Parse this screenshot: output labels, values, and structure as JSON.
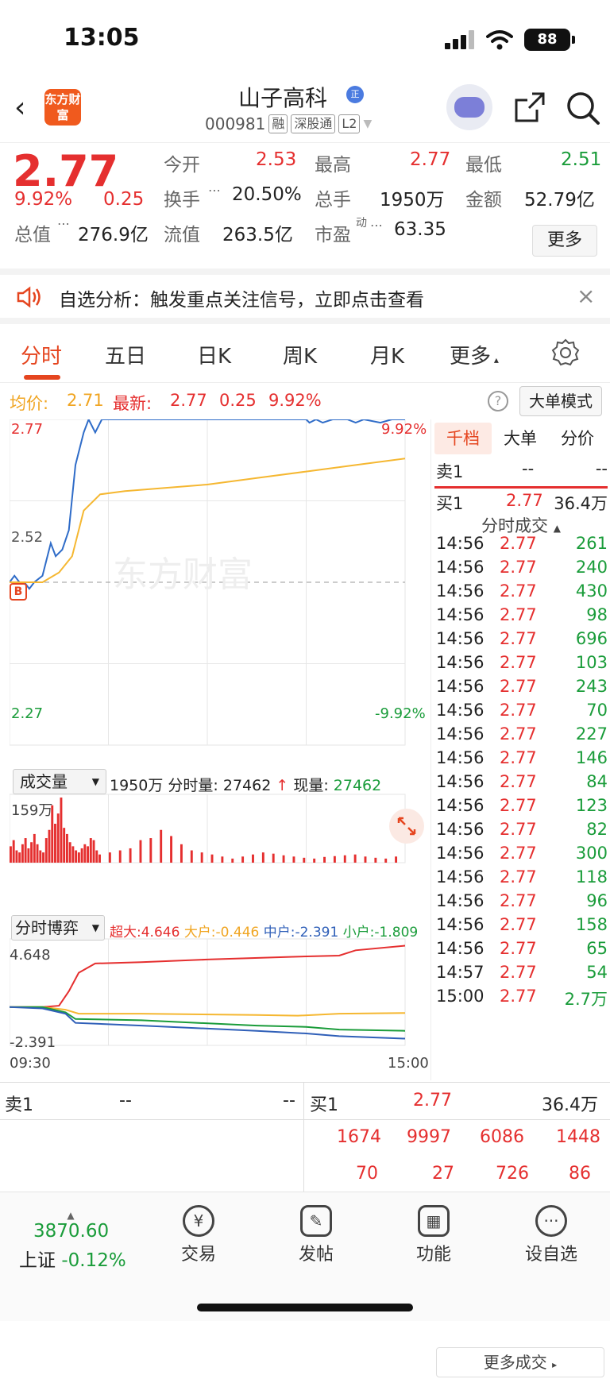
{
  "status_bar": {
    "time": "13:05",
    "battery": "88"
  },
  "header": {
    "logo_text": "东方财富",
    "stock_name": "山子高科",
    "verified_badge": "正",
    "code": "000981",
    "tags": [
      "融",
      "深股通",
      "L2"
    ]
  },
  "quote": {
    "price": "2.77",
    "change_pct": "9.92%",
    "change": "0.25",
    "open_label": "今开",
    "open": "2.53",
    "high_label": "最高",
    "high": "2.77",
    "low_label": "最低",
    "low": "2.51",
    "turnover_label": "换手",
    "turnover": "20.50%",
    "volume_label": "总手",
    "volume": "1950万",
    "amount_label": "金额",
    "amount": "52.79亿",
    "mktcap_label": "总值",
    "mktcap": "276.9亿",
    "float_label": "流值",
    "float": "263.5亿",
    "pe_label": "市盈",
    "pe_sup": "动",
    "pe": "63.35",
    "more": "更多"
  },
  "alert": {
    "text": "自选分析：触发重点关注信号，立即点击查看",
    "close": "×"
  },
  "tabs": [
    {
      "label": "分时",
      "active": true
    },
    {
      "label": "五日"
    },
    {
      "label": "日K"
    },
    {
      "label": "周K"
    },
    {
      "label": "月K"
    },
    {
      "label": "更多"
    }
  ],
  "chart_info": {
    "avg_label": "均价:",
    "avg": "2.71",
    "latest_label": "最新:",
    "latest": "2.77",
    "change": "0.25",
    "change_pct": "9.92%",
    "help": "?",
    "big_mode": "大单模式"
  },
  "chart_data": {
    "type": "line",
    "price_axis": {
      "top": "2.77",
      "mid": "2.52",
      "bottom": "2.27",
      "top_pct": "9.92%",
      "bottom_pct": "-9.92%"
    },
    "ylim": [
      2.27,
      2.77
    ],
    "prev_close": 2.52,
    "watermark": "东方财富",
    "marker": "B",
    "series": [
      {
        "color": "#2f6cc8",
        "points": [
          [
            0,
            2.52
          ],
          [
            3,
            2.53
          ],
          [
            6,
            2.52
          ],
          [
            9,
            2.52
          ],
          [
            12,
            2.51
          ],
          [
            15,
            2.52
          ],
          [
            20,
            2.53
          ],
          [
            25,
            2.58
          ],
          [
            28,
            2.56
          ],
          [
            32,
            2.57
          ],
          [
            36,
            2.6
          ],
          [
            40,
            2.7
          ],
          [
            45,
            2.75
          ],
          [
            48,
            2.77
          ],
          [
            52,
            2.75
          ],
          [
            56,
            2.77
          ],
          [
            100,
            2.77
          ],
          [
            150,
            2.77
          ],
          [
            180,
            2.77
          ],
          [
            182,
            2.765
          ],
          [
            186,
            2.77
          ],
          [
            190,
            2.765
          ],
          [
            196,
            2.77
          ],
          [
            205,
            2.77
          ],
          [
            210,
            2.765
          ],
          [
            215,
            2.77
          ],
          [
            225,
            2.765
          ],
          [
            232,
            2.77
          ],
          [
            240,
            2.77
          ]
        ]
      },
      {
        "color": "#f5b731",
        "points": [
          [
            0,
            2.52
          ],
          [
            10,
            2.52
          ],
          [
            20,
            2.52
          ],
          [
            30,
            2.535
          ],
          [
            38,
            2.56
          ],
          [
            45,
            2.63
          ],
          [
            55,
            2.655
          ],
          [
            70,
            2.66
          ],
          [
            95,
            2.665
          ],
          [
            120,
            2.67
          ],
          [
            150,
            2.68
          ],
          [
            180,
            2.69
          ],
          [
            210,
            2.7
          ],
          [
            240,
            2.71
          ]
        ]
      }
    ],
    "volume": {
      "max_label": "159万",
      "bars": [
        40,
        55,
        30,
        25,
        45,
        60,
        35,
        50,
        70,
        45,
        30,
        25,
        60,
        80,
        140,
        95,
        120,
        159,
        85,
        70,
        50,
        40,
        30,
        25,
        35,
        45,
        40,
        60,
        55,
        30,
        20,
        25,
        30,
        35,
        55,
        60,
        80,
        65,
        45,
        30,
        25,
        20,
        15,
        10,
        15,
        20,
        25,
        22,
        18,
        15,
        12,
        10,
        14,
        16,
        18,
        20,
        15,
        12,
        10,
        15
      ]
    },
    "flow": {
      "ymax_label": "4.648",
      "ymin_label": "-2.391",
      "xstart": "09:30",
      "xend": "15:00"
    }
  },
  "volume_bar": {
    "dropdown": "成交量",
    "total": "1950万",
    "fs_label": "分时量:",
    "fs": "27462",
    "now_label": "现量:",
    "now": "27462"
  },
  "flow_bar": {
    "dropdown": "分时博弈",
    "xl": "超大:4.646",
    "big": "大户:-0.446",
    "mid": "中户:-2.391",
    "small": "小户:-1.809"
  },
  "right_panel": {
    "tabs": [
      "千档",
      "大单",
      "分价"
    ],
    "sell1_label": "卖1",
    "sell1_price": "--",
    "sell1_vol": "--",
    "buy1_label": "买1",
    "buy1_price": "2.77",
    "buy1_vol": "36.4万",
    "trades_header": "分时成交",
    "trades": [
      [
        "14:56",
        "2.77",
        "261"
      ],
      [
        "14:56",
        "2.77",
        "240"
      ],
      [
        "14:56",
        "2.77",
        "430"
      ],
      [
        "14:56",
        "2.77",
        "98"
      ],
      [
        "14:56",
        "2.77",
        "696"
      ],
      [
        "14:56",
        "2.77",
        "103"
      ],
      [
        "14:56",
        "2.77",
        "243"
      ],
      [
        "14:56",
        "2.77",
        "70"
      ],
      [
        "14:56",
        "2.77",
        "227"
      ],
      [
        "14:56",
        "2.77",
        "146"
      ],
      [
        "14:56",
        "2.77",
        "84"
      ],
      [
        "14:56",
        "2.77",
        "123"
      ],
      [
        "14:56",
        "2.77",
        "82"
      ],
      [
        "14:56",
        "2.77",
        "300"
      ],
      [
        "14:56",
        "2.77",
        "118"
      ],
      [
        "14:56",
        "2.77",
        "96"
      ],
      [
        "14:56",
        "2.77",
        "158"
      ],
      [
        "14:56",
        "2.77",
        "65"
      ],
      [
        "14:57",
        "2.77",
        "54"
      ],
      [
        "15:00",
        "2.77",
        "2.7万"
      ]
    ],
    "more_trades": "更多成交"
  },
  "bottom_book": {
    "sell_label": "卖1",
    "sell_price": "--",
    "sell_vol": "--",
    "buy_label": "买1",
    "buy_price": "2.77",
    "buy_vol": "36.4万",
    "row1": [
      "1674",
      "9997",
      "6086",
      "1448"
    ],
    "row2": [
      "70",
      "27",
      "726",
      "86"
    ]
  },
  "nav": {
    "index_value": "3870.60",
    "index_name": "上证",
    "index_change": "-0.12%",
    "items": [
      "交易",
      "发帖",
      "功能",
      "设自选"
    ]
  }
}
